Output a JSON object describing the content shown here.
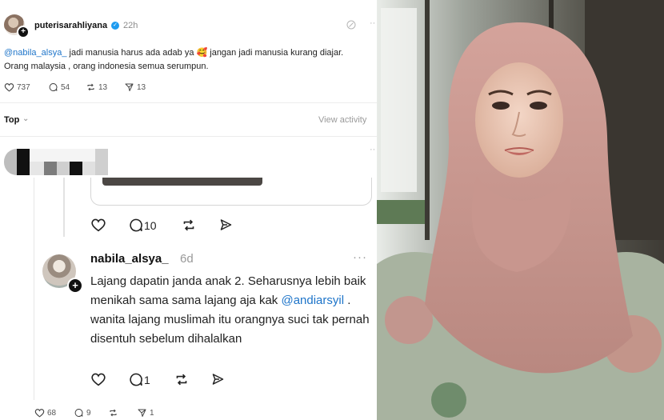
{
  "header": {
    "username": "puterisarahliyana",
    "time": "22h"
  },
  "post": {
    "mention": "@nabila_alsya_",
    "text_line1_rest": " jadi manusia harus ada adab ya 🥰 jangan jadi manusia kurang diajar.",
    "text_line2": "Orang malaysia , orang indonesia semua serumpun.",
    "stats": {
      "likes": "737",
      "replies": "54",
      "reposts": "13",
      "shares": "13"
    }
  },
  "sort": {
    "label": "Top",
    "view_activity": "View activity"
  },
  "inner": {
    "prev_actions": {
      "replies": "10"
    },
    "reply": {
      "username": "nabila_alsya_",
      "time": "6d",
      "text_before": "Lajang dapatin janda anak 2. Seharusnya lebih baik menikah sama sama lajang aja kak ",
      "mention": "@andiarsyil",
      "text_after": " . wanita lajang muslimah itu orangnya suci tak pernah disentuh sebelum dihalalkan"
    },
    "reply_actions": {
      "replies": "1"
    }
  },
  "bottom_stats": {
    "likes": "68",
    "replies": "9",
    "shares": "1"
  },
  "colors": {
    "mention": "#1d74c9",
    "verified": "#1d9bf0",
    "hijab": "#c99a92"
  }
}
